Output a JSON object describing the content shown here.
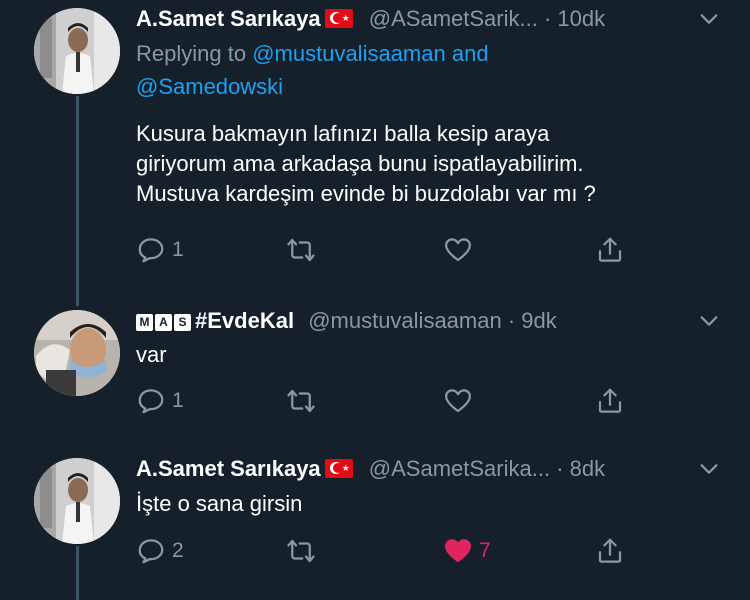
{
  "tweets": [
    {
      "display_name": "A.Samet Sarıkaya",
      "handle": "@ASametSarik...",
      "time": "· 10dk",
      "replying_prefix": "Replying to",
      "replying_user1": "@mustuvalisaaman",
      "replying_and": "and",
      "replying_user2": "@Samedowski",
      "text_line1": "Kusura bakmayın lafınızı balla kesip araya",
      "text_line2": "giriyorum ama arkadaşa bunu ispatlayabilirim.",
      "text_line3": "Mustuva kardeşim evinde bi buzdolabı var mı ?",
      "reply_count": "1",
      "retweet_count": "",
      "like_count": ""
    },
    {
      "badge_letters": [
        "M",
        "A",
        "S"
      ],
      "display_name": "#EvdeKal",
      "handle": "@mustuvalisaaman",
      "time": "· 9dk",
      "text_line1": "var",
      "reply_count": "1",
      "retweet_count": "",
      "like_count": ""
    },
    {
      "display_name": "A.Samet Sarıkaya",
      "handle": "@ASametSarika...",
      "time": "· 8dk",
      "text_line1": "İşte o sana girsin",
      "reply_count": "2",
      "retweet_count": "",
      "like_count": "7",
      "liked": true
    }
  ],
  "colors": {
    "background": "#15202b",
    "text": "#ffffff",
    "muted": "#8899a6",
    "link": "#1da1f2",
    "like": "#e0245e",
    "thread_line": "#3d5466",
    "flag_red": "#e30a17"
  },
  "icons": [
    "reply-icon",
    "retweet-icon",
    "like-icon",
    "share-icon",
    "chevron-down-icon",
    "turkey-flag-icon"
  ]
}
